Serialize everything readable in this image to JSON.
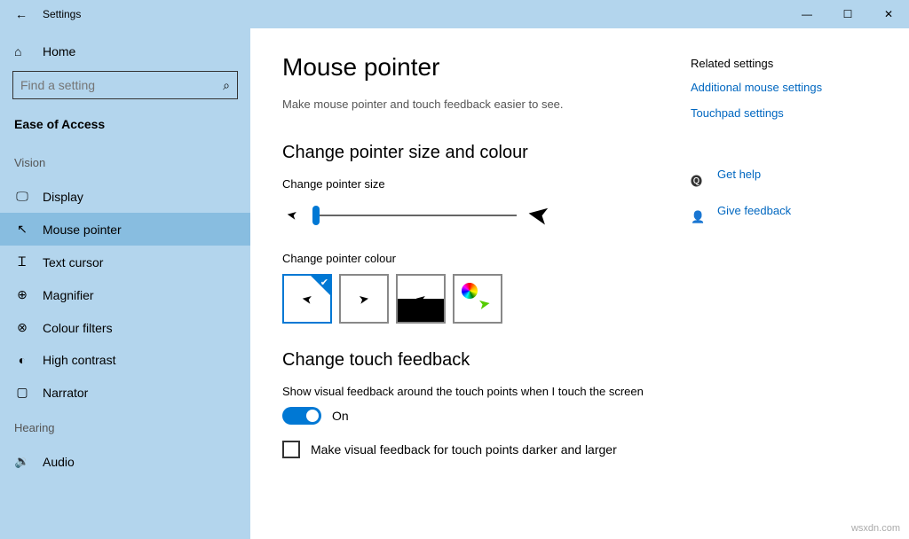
{
  "window": {
    "title": "Settings"
  },
  "sidebar": {
    "home": "Home",
    "search_placeholder": "Find a setting",
    "section": "Ease of Access",
    "groups": [
      {
        "label": "Vision",
        "items": [
          {
            "label": "Display",
            "selected": false
          },
          {
            "label": "Mouse pointer",
            "selected": true
          },
          {
            "label": "Text cursor",
            "selected": false
          },
          {
            "label": "Magnifier",
            "selected": false
          },
          {
            "label": "Colour filters",
            "selected": false
          },
          {
            "label": "High contrast",
            "selected": false
          },
          {
            "label": "Narrator",
            "selected": false
          }
        ]
      },
      {
        "label": "Hearing",
        "items": [
          {
            "label": "Audio",
            "selected": false
          }
        ]
      }
    ]
  },
  "main": {
    "title": "Mouse pointer",
    "description": "Make mouse pointer and touch feedback easier to see.",
    "sec1_title": "Change pointer size and colour",
    "size_label": "Change pointer size",
    "colour_label": "Change pointer colour",
    "sec2_title": "Change touch feedback",
    "touch_desc": "Show visual feedback around the touch points when I touch the screen",
    "toggle_state": "On",
    "checkbox_label": "Make visual feedback for touch points darker and larger"
  },
  "right": {
    "heading": "Related settings",
    "link1": "Additional mouse settings",
    "link2": "Touchpad settings",
    "help": "Get help",
    "feedback": "Give feedback"
  },
  "watermark": "wsxdn.com"
}
